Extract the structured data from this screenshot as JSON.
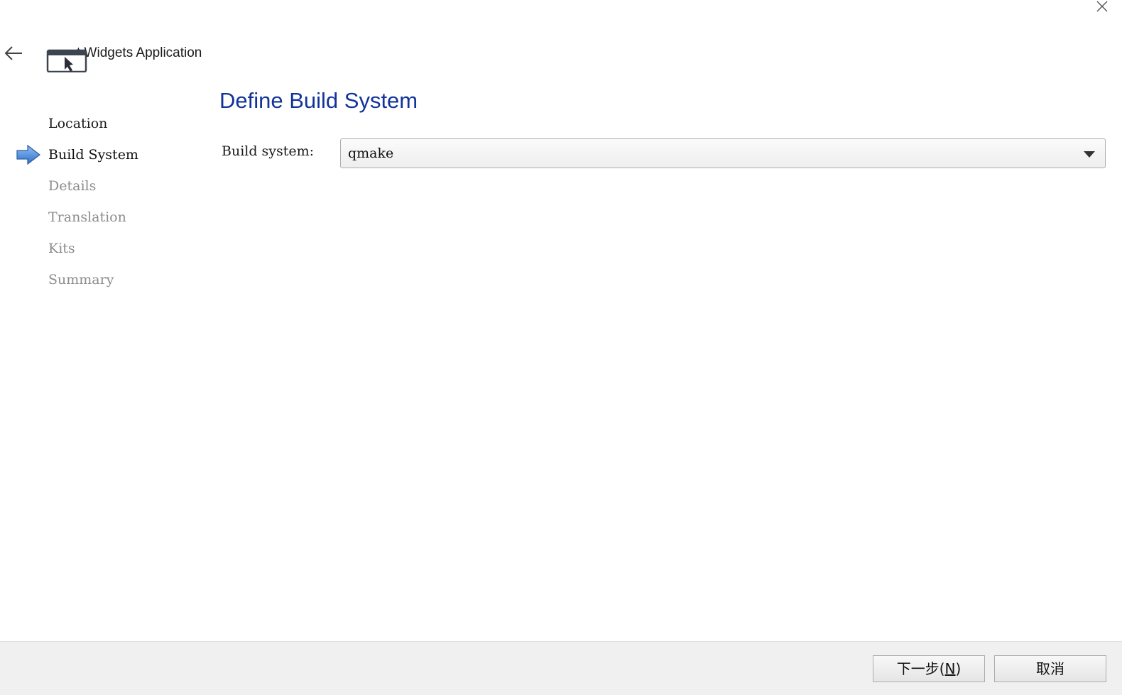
{
  "window": {
    "close_icon": "close-icon"
  },
  "header": {
    "back_icon": "back-arrow-icon",
    "app_icon": "qt-widgets-app-icon",
    "title": "t Widgets Application"
  },
  "steps": [
    {
      "label": "Location",
      "state": "done"
    },
    {
      "label": "Build System",
      "state": "current"
    },
    {
      "label": "Details",
      "state": "pending"
    },
    {
      "label": "Translation",
      "state": "pending"
    },
    {
      "label": "Kits",
      "state": "pending"
    },
    {
      "label": "Summary",
      "state": "pending"
    }
  ],
  "page": {
    "title": "Define Build System",
    "field_label": "Build system:",
    "build_system_value": "qmake"
  },
  "footer": {
    "next_label_prefix": "下一步(",
    "next_mnemonic": "N",
    "next_label_suffix": ")",
    "cancel_label": "取消"
  },
  "colors": {
    "title_blue": "#12349a",
    "current_arrow": "#3b7fd9",
    "pending_text": "#8c8c8c"
  }
}
